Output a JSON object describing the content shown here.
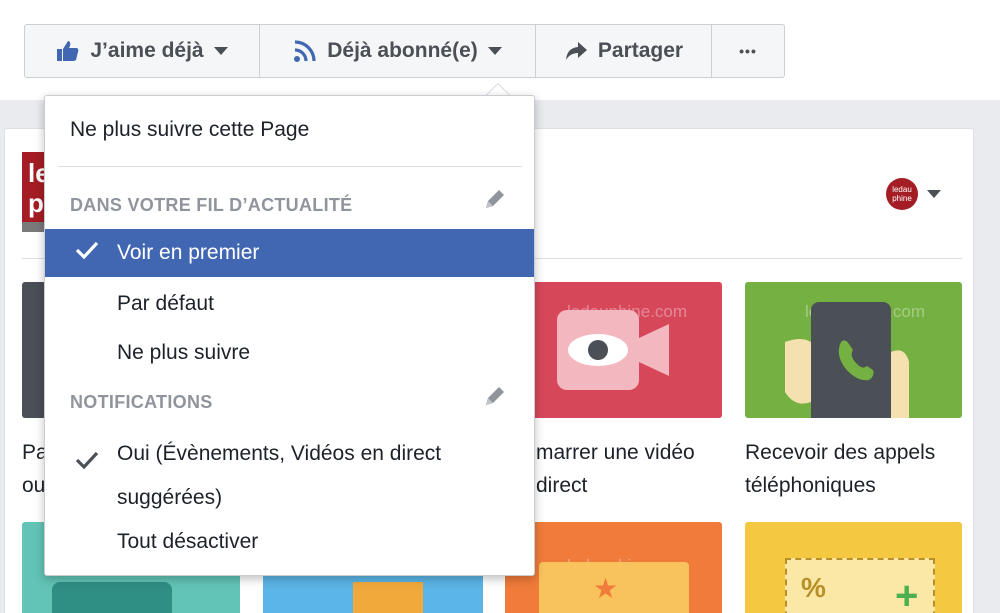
{
  "actions": {
    "like_label": "J’aime déjà",
    "follow_label": "Déjà abonné(e)",
    "share_label": "Partager",
    "more_label": "•••"
  },
  "page": {
    "logo_text": "le\np",
    "avatar_text": "ledau\nphine",
    "tiles": {
      "left_text": "Pa\nou",
      "video_text": "marrer une vidéo\ndirect",
      "calls_text": "Recevoir des appels\ntéléphoniques"
    },
    "watermark": "ledauphine.com"
  },
  "dropdown": {
    "unfollow_page": "Ne plus suivre cette Page",
    "feed_header": "DANS VOTRE FIL D’ACTUALITÉ",
    "feed_options": [
      {
        "label": "Voir en premier",
        "selected": true
      },
      {
        "label": "Par défaut",
        "selected": false
      },
      {
        "label": "Ne plus suivre",
        "selected": false
      }
    ],
    "notif_header": "NOTIFICATIONS",
    "notif_options": [
      {
        "label": "Oui (Évènements, Vidéos en direct suggérées)",
        "selected": true
      },
      {
        "label": "Tout désactiver",
        "selected": false
      }
    ]
  },
  "colors": {
    "accent": "#4267b2",
    "icon_blue": "#4267b2",
    "muted": "#90949c"
  }
}
